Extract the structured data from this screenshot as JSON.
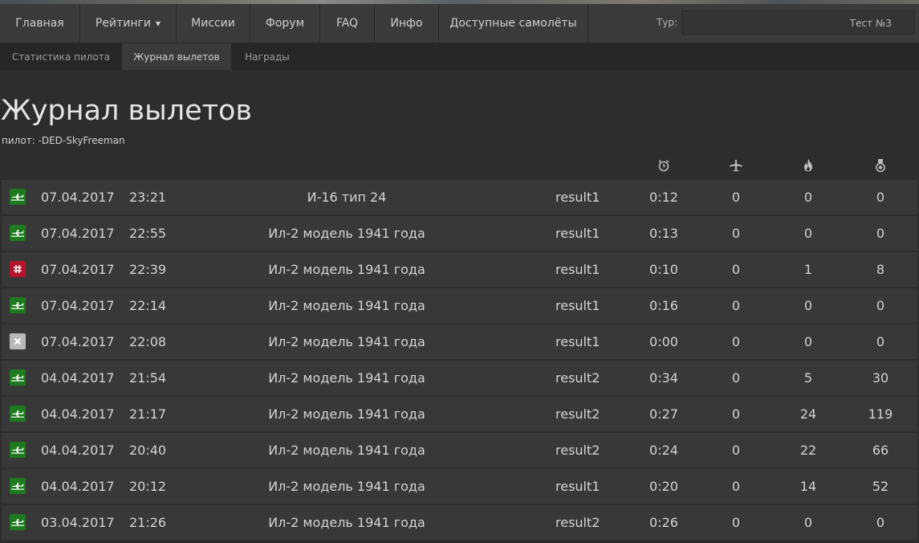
{
  "nav": {
    "items": [
      {
        "label": "Главная"
      },
      {
        "label": "Рейтинги",
        "dropdown": true
      },
      {
        "label": "Миссии"
      },
      {
        "label": "Форум"
      },
      {
        "label": "FAQ"
      },
      {
        "label": "Инфо"
      },
      {
        "label": "Доступные самолёты"
      }
    ],
    "tour_label": "Тур:",
    "tour_value": "Тест №3"
  },
  "subnav": {
    "tabs": [
      {
        "label": "Статистика пилота",
        "active": false
      },
      {
        "label": "Журнал вылетов",
        "active": true
      },
      {
        "label": "Награды",
        "active": false
      }
    ]
  },
  "page": {
    "title": "Журнал вылетов",
    "pilot_label": "пилот:",
    "pilot_name": "-DED-SkyFreeman"
  },
  "table": {
    "header_icons": [
      "alarm-clock-icon",
      "aircraft-icon",
      "flame-icon",
      "medal-icon"
    ],
    "rows": [
      {
        "status": "landed",
        "status_icon": "landed-plane-icon",
        "date": "07.04.2017",
        "time": "23:21",
        "aircraft": "И-16 тип 24",
        "result": "result1",
        "duration": "0:12",
        "col_a": "0",
        "col_b": "0",
        "col_c": "0"
      },
      {
        "status": "landed",
        "status_icon": "landed-plane-icon",
        "date": "07.04.2017",
        "time": "22:55",
        "aircraft": "Ил-2 модель 1941 года",
        "result": "result1",
        "duration": "0:13",
        "col_a": "0",
        "col_b": "0",
        "col_c": "0"
      },
      {
        "status": "destroyed",
        "status_icon": "crash-grid-icon",
        "date": "07.04.2017",
        "time": "22:39",
        "aircraft": "Ил-2 модель 1941 года",
        "result": "result1",
        "duration": "0:10",
        "col_a": "0",
        "col_b": "1",
        "col_c": "8"
      },
      {
        "status": "landed",
        "status_icon": "landed-plane-icon",
        "date": "07.04.2017",
        "time": "22:14",
        "aircraft": "Ил-2 модель 1941 года",
        "result": "result1",
        "duration": "0:16",
        "col_a": "0",
        "col_b": "0",
        "col_c": "0"
      },
      {
        "status": "aborted",
        "status_icon": "close-x-icon",
        "date": "07.04.2017",
        "time": "22:08",
        "aircraft": "Ил-2 модель 1941 года",
        "result": "result1",
        "duration": "0:00",
        "col_a": "0",
        "col_b": "0",
        "col_c": "0"
      },
      {
        "status": "landed",
        "status_icon": "landed-plane-icon",
        "date": "04.04.2017",
        "time": "21:54",
        "aircraft": "Ил-2 модель 1941 года",
        "result": "result2",
        "duration": "0:34",
        "col_a": "0",
        "col_b": "5",
        "col_c": "30"
      },
      {
        "status": "landed",
        "status_icon": "landed-plane-icon",
        "date": "04.04.2017",
        "time": "21:17",
        "aircraft": "Ил-2 модель 1941 года",
        "result": "result2",
        "duration": "0:27",
        "col_a": "0",
        "col_b": "24",
        "col_c": "119"
      },
      {
        "status": "landed",
        "status_icon": "landed-plane-icon",
        "date": "04.04.2017",
        "time": "20:40",
        "aircraft": "Ил-2 модель 1941 года",
        "result": "result2",
        "duration": "0:24",
        "col_a": "0",
        "col_b": "22",
        "col_c": "66"
      },
      {
        "status": "landed",
        "status_icon": "landed-plane-icon",
        "date": "04.04.2017",
        "time": "20:12",
        "aircraft": "Ил-2 модель 1941 года",
        "result": "result1",
        "duration": "0:20",
        "col_a": "0",
        "col_b": "14",
        "col_c": "52"
      },
      {
        "status": "landed",
        "status_icon": "landed-plane-icon",
        "date": "03.04.2017",
        "time": "21:26",
        "aircraft": "Ил-2 модель 1941 года",
        "result": "result2",
        "duration": "0:26",
        "col_a": "0",
        "col_b": "0",
        "col_c": "0"
      }
    ]
  },
  "colors": {
    "landed": "#1e7a1e",
    "destroyed": "#b3142a",
    "aborted": "#b8b8b8"
  }
}
